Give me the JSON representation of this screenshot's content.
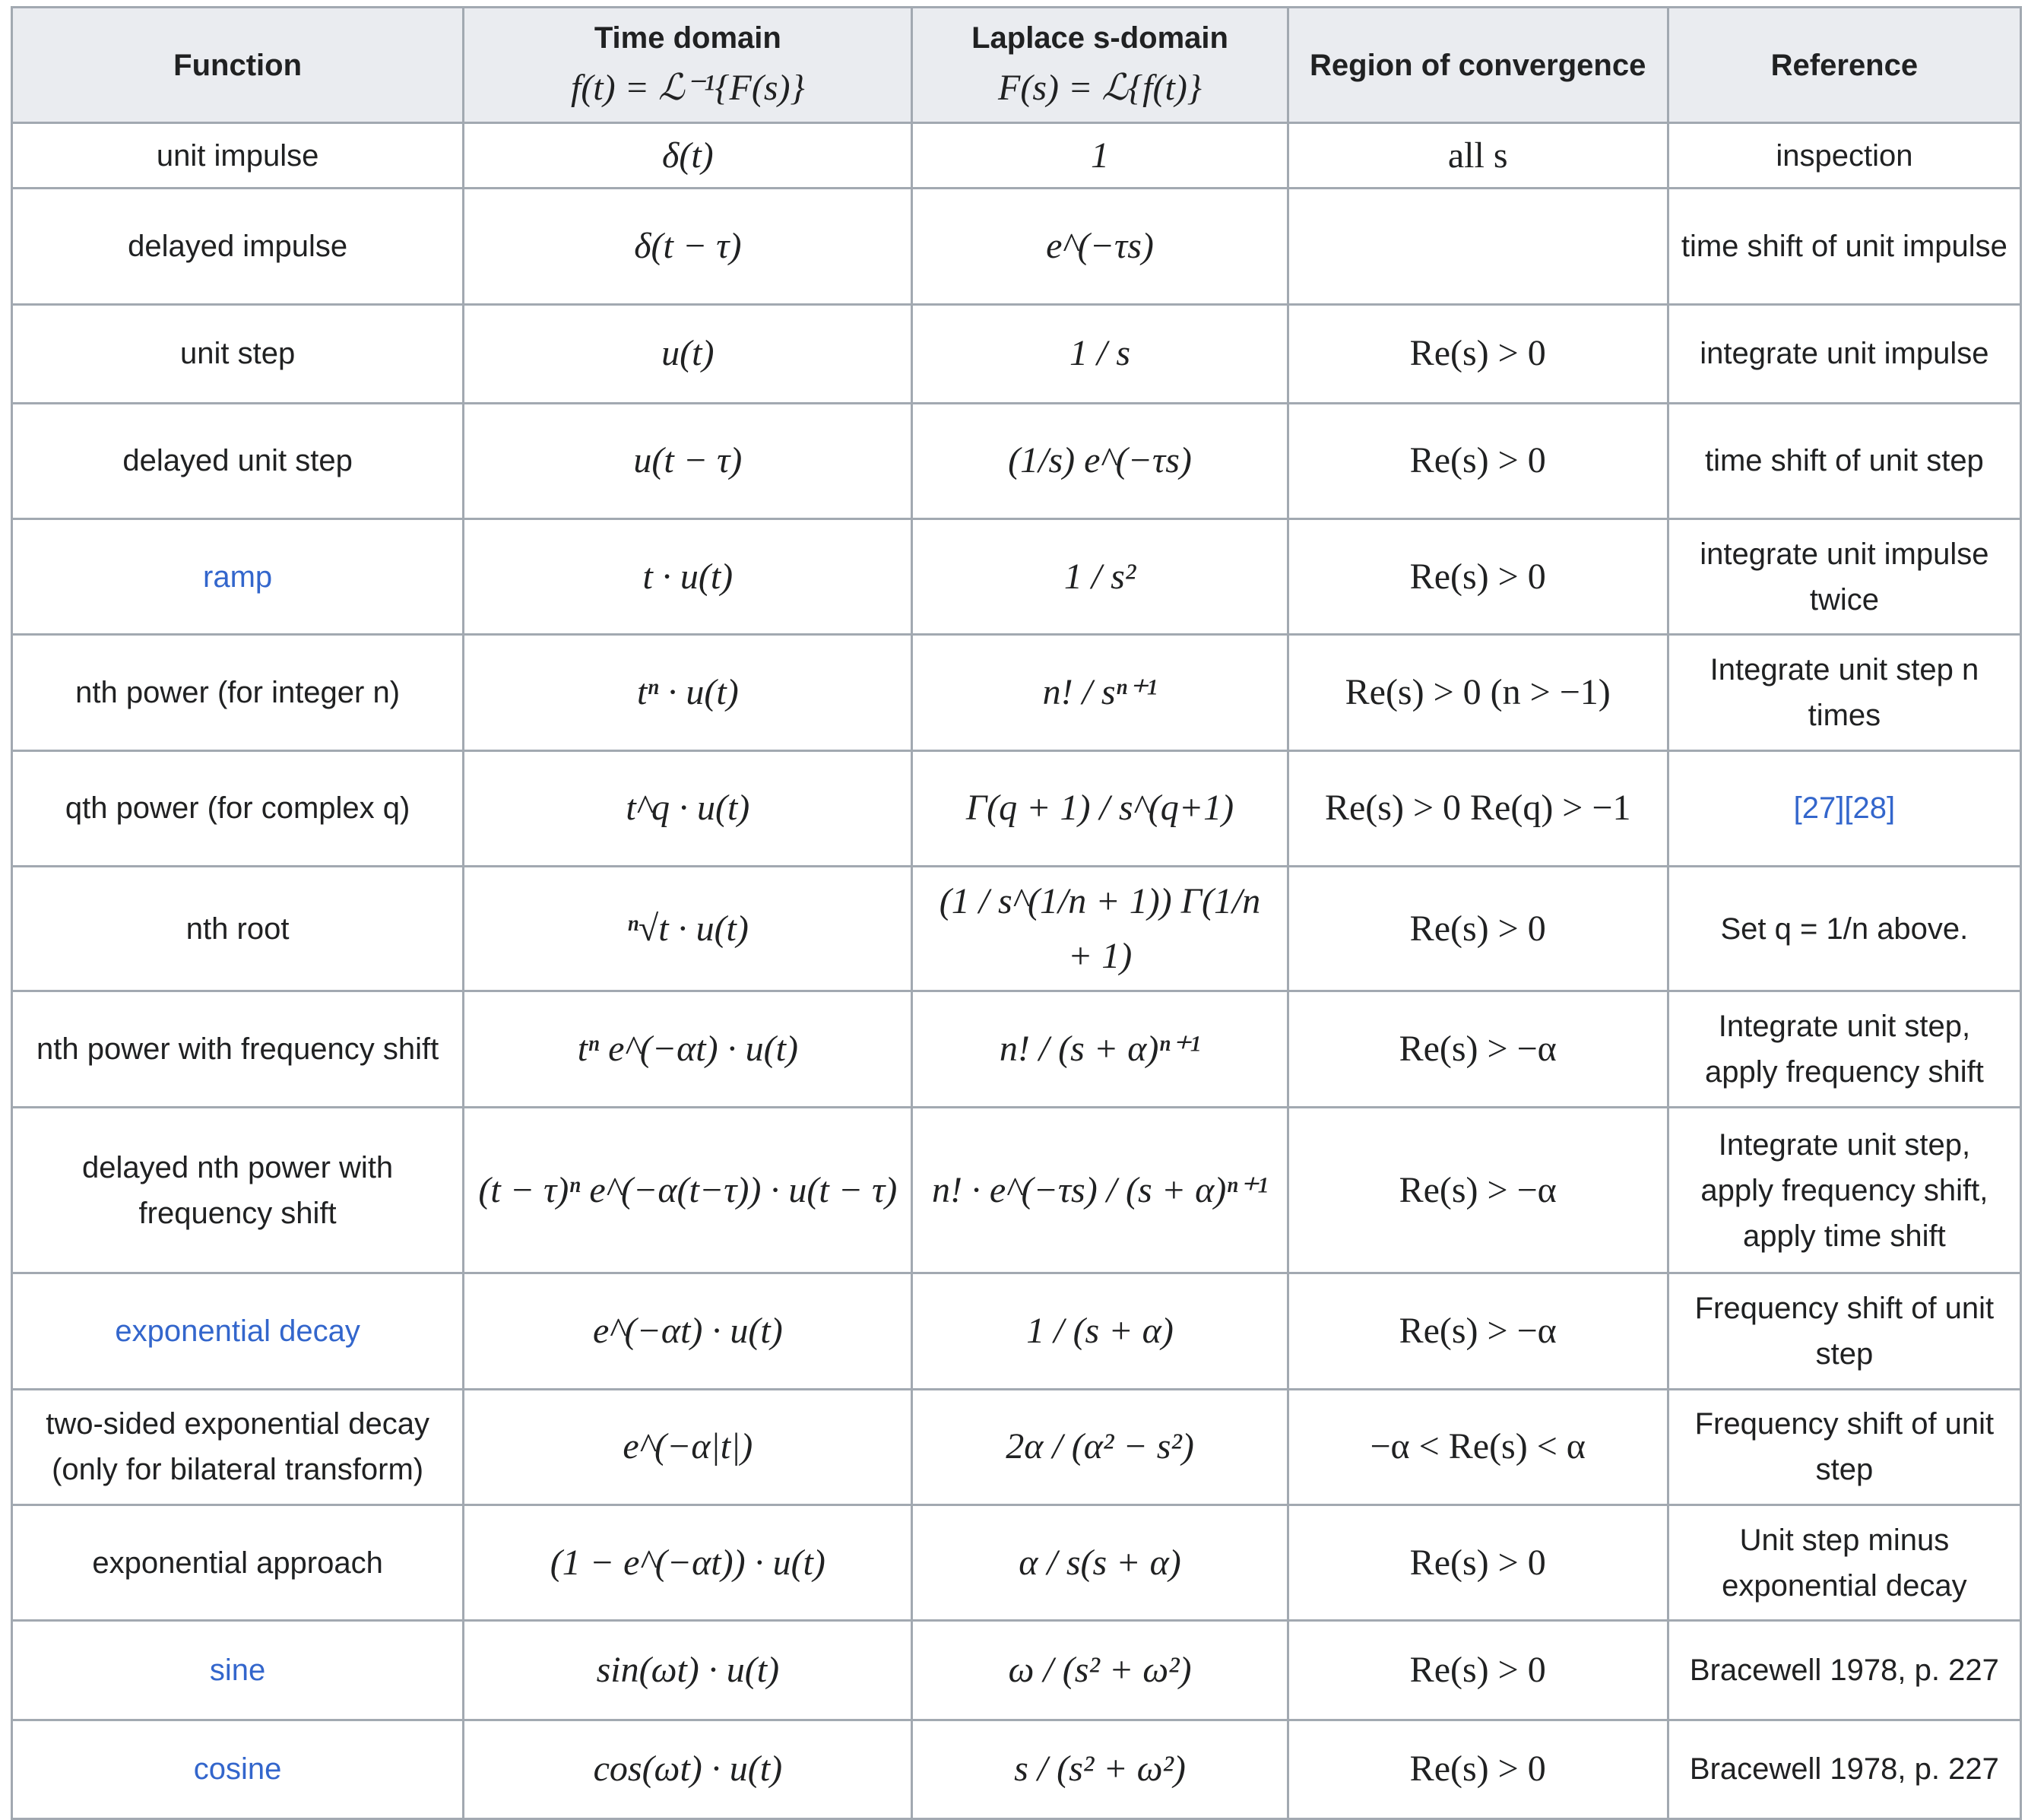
{
  "headers": {
    "function": "Function",
    "time_domain": "Time domain",
    "time_domain_formula": "f(t) = ℒ⁻¹{F(s)}",
    "laplace_domain": "Laplace s-domain",
    "laplace_domain_formula": "F(s) = ℒ{f(t)}",
    "roc": "Region of convergence",
    "reference": "Reference"
  },
  "rows": [
    {
      "func": "unit impulse",
      "func_link": false,
      "time": "δ(t)",
      "laplace": "1",
      "roc": "all s",
      "ref": "inspection"
    },
    {
      "func": "delayed impulse",
      "func_link": false,
      "time": "δ(t − τ)",
      "laplace": "e^(−τs)",
      "roc": "",
      "ref": "time shift of unit impulse"
    },
    {
      "func": "unit step",
      "func_link": false,
      "time": "u(t)",
      "laplace": "1 / s",
      "roc": "Re(s) > 0",
      "ref": "integrate unit impulse"
    },
    {
      "func": "delayed unit step",
      "func_link": false,
      "time": "u(t − τ)",
      "laplace": "(1/s) e^(−τs)",
      "roc": "Re(s) > 0",
      "ref": "time shift of unit step"
    },
    {
      "func": "ramp",
      "func_link": true,
      "time": "t · u(t)",
      "laplace": "1 / s²",
      "roc": "Re(s) > 0",
      "ref": "integrate unit impulse twice"
    },
    {
      "func": "nth power (for integer n)",
      "func_link": false,
      "time": "tⁿ · u(t)",
      "laplace": "n! / sⁿ⁺¹",
      "roc": "Re(s) > 0 (n > −1)",
      "ref": "Integrate unit step n times"
    },
    {
      "func": "qth power (for complex q)",
      "func_link": false,
      "time": "t^q · u(t)",
      "laplace": "Γ(q + 1) / s^(q+1)",
      "roc": "Re(s) > 0 Re(q) > −1",
      "ref": "[27][28]",
      "ref_link": true
    },
    {
      "func": "nth root",
      "func_link": false,
      "time": "ⁿ√t · u(t)",
      "laplace": "(1 / s^(1/n + 1)) Γ(1/n + 1)",
      "roc": "Re(s) > 0",
      "ref": "Set q = 1/n above."
    },
    {
      "func": "nth power with frequency shift",
      "func_link": false,
      "time": "tⁿ e^(−αt) · u(t)",
      "laplace": "n! / (s + α)ⁿ⁺¹",
      "roc": "Re(s) > −α",
      "ref": "Integrate unit step, apply frequency shift"
    },
    {
      "func": "delayed nth power with frequency shift",
      "func_link": false,
      "time": "(t − τ)ⁿ e^(−α(t−τ)) · u(t − τ)",
      "laplace": "n! · e^(−τs) / (s + α)ⁿ⁺¹",
      "roc": "Re(s) > −α",
      "ref": "Integrate unit step, apply frequency shift, apply time shift"
    },
    {
      "func": "exponential decay",
      "func_link": true,
      "time": "e^(−αt) · u(t)",
      "laplace": "1 / (s + α)",
      "roc": "Re(s) > −α",
      "ref": "Frequency shift of unit step"
    },
    {
      "func": "two-sided exponential decay (only for bilateral transform)",
      "func_link": "partial",
      "time": "e^(−α|t|)",
      "laplace": "2α / (α² − s²)",
      "roc": "−α < Re(s) < α",
      "ref": "Frequency shift of unit step"
    },
    {
      "func": "exponential approach",
      "func_link": false,
      "time": "(1 − e^(−αt)) · u(t)",
      "laplace": "α / s(s + α)",
      "roc": "Re(s) > 0",
      "ref": "Unit step minus exponential decay"
    },
    {
      "func": "sine",
      "func_link": true,
      "time": "sin(ωt) · u(t)",
      "laplace": "ω / (s² + ω²)",
      "roc": "Re(s) > 0",
      "ref": "Bracewell 1978, p. 227"
    },
    {
      "func": "cosine",
      "func_link": true,
      "time": "cos(ωt) · u(t)",
      "laplace": "s / (s² + ω²)",
      "roc": "Re(s) > 0",
      "ref": "Bracewell 1978, p. 227"
    }
  ],
  "colors": {
    "link": "#3366cc",
    "header_bg": "#eaecf0",
    "border": "#a2a9b1",
    "text": "#202122"
  }
}
